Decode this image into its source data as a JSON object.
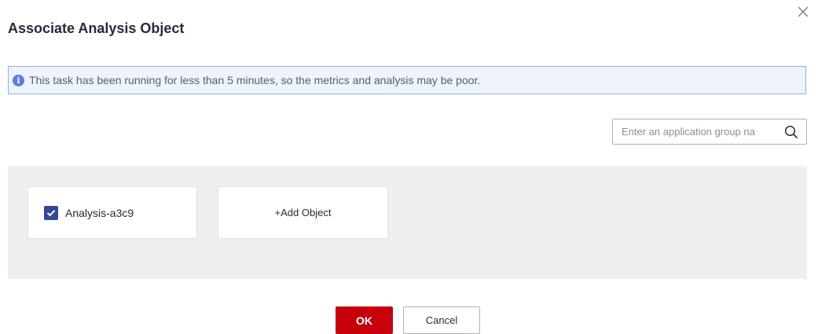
{
  "dialog": {
    "title": "Associate Analysis Object"
  },
  "alert": {
    "icon": "info-icon",
    "message": "This task has been running for less than 5 minutes, so the metrics and analysis may be poor."
  },
  "search": {
    "placeholder": "Enter an application group na",
    "value": "",
    "icon": "search-icon"
  },
  "objects": [
    {
      "label": "Analysis-a3c9",
      "checked": true
    }
  ],
  "add_object": {
    "label": "+Add Object"
  },
  "footer": {
    "ok_label": "OK",
    "cancel_label": "Cancel"
  },
  "colors": {
    "primary_button": "#c7000b",
    "checkbox": "#344899",
    "alert_background": "#eef3fe",
    "alert_border": "#8ab1ec",
    "panel_background": "#eeeff1"
  }
}
